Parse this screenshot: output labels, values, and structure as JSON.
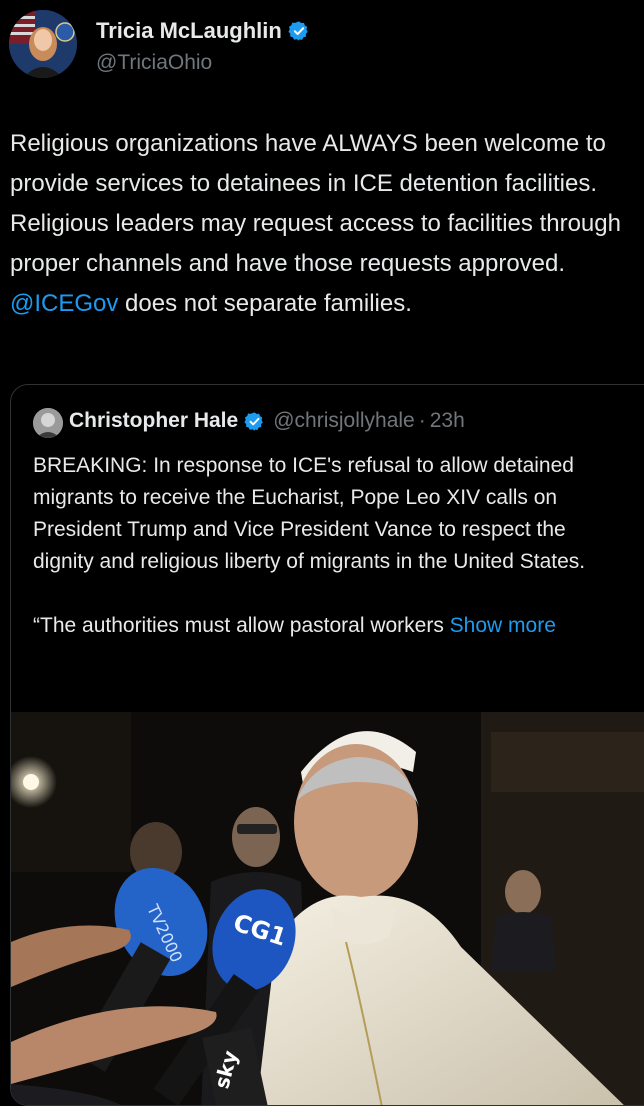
{
  "author": {
    "display_name": "Tricia McLaughlin",
    "handle": "@TriciaOhio",
    "verified_icon": "verified-badge-icon"
  },
  "tweet": {
    "text_before_mention": "Religious organizations have ALWAYS been welcome to provide services to detainees in ICE detention facilities. Religious leaders may request access to facilities through proper channels and have those requests approved. ",
    "mention": "@ICEGov",
    "text_after_mention": " does not separate families."
  },
  "quoted_tweet": {
    "display_name": "Christopher Hale",
    "handle": "@chrisjollyhale",
    "separator": "·",
    "time": "23h",
    "paragraph_1": "BREAKING: In response to ICE's refusal to allow detained migrants to receive the Eucharist, Pope Leo XIV calls on President Trump and Vice President Vance to respect the dignity and religious liberty of migrants in the United States.",
    "paragraph_2": "“The authorities must allow pastoral workers ",
    "show_more": "Show more",
    "photo_text": {
      "mic1": "TV2000",
      "mic2": "CG1",
      "mic3": "sky"
    }
  },
  "colors": {
    "background": "#000000",
    "text": "#e7e9ea",
    "secondary": "#71767b",
    "accent": "#1d9bf0",
    "border": "#2f3336"
  }
}
